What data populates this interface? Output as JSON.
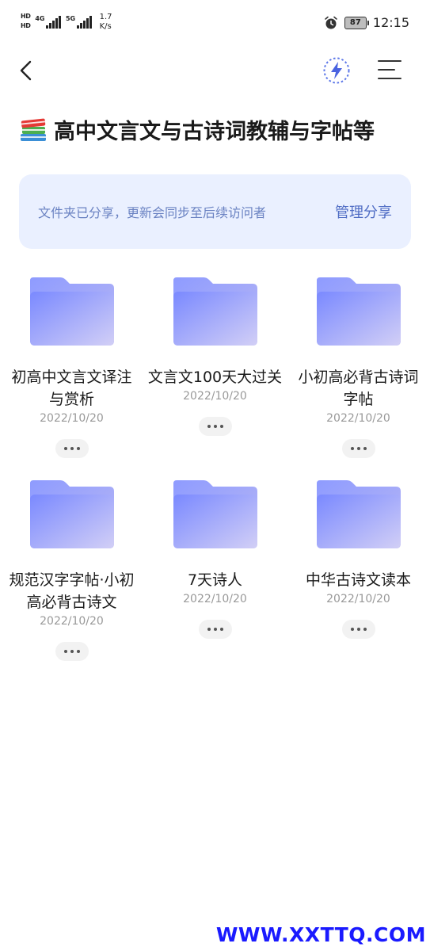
{
  "status_bar": {
    "sim1": "HD",
    "sim2": "HD",
    "net1": "4G",
    "net2": "5G",
    "speed_value": "1.7",
    "speed_unit": "K/s",
    "battery": "87",
    "time": "12:15"
  },
  "header": {
    "back_icon": "chevron-left-icon",
    "flash_icon": "lightning-icon",
    "menu_icon": "menu-icon"
  },
  "title": "高中文言文与古诗词教辅与字帖等",
  "share_banner": {
    "text": "文件夹已分享，更新会同步至后续访问者",
    "action": "管理分享"
  },
  "folders": [
    {
      "name": "初高中文言文译注与赏析",
      "date": "2022/10/20"
    },
    {
      "name": "文言文100天大过关",
      "date": "2022/10/20"
    },
    {
      "name": "小初高必背古诗词字帖",
      "date": "2022/10/20"
    },
    {
      "name": "规范汉字字帖·小初高必背古诗文",
      "date": "2022/10/20"
    },
    {
      "name": "7天诗人",
      "date": "2022/10/20"
    },
    {
      "name": "中华古诗文读本",
      "date": "2022/10/20"
    }
  ],
  "watermark": "WWW.XXTTQ.COM",
  "colors": {
    "banner_bg": "#eaf0ff",
    "banner_text": "#6a82c2",
    "banner_action": "#4f6cc4",
    "folder_start": "#7e8cff",
    "folder_end": "#c9c6f5",
    "watermark": "#1a1aff"
  }
}
